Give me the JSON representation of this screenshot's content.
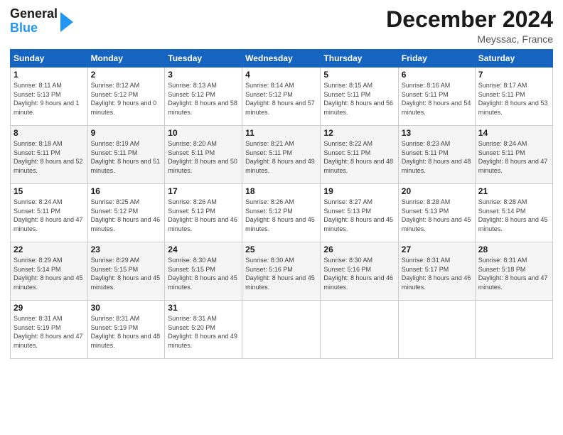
{
  "logo": {
    "general": "General",
    "blue": "Blue"
  },
  "header": {
    "month": "December 2024",
    "location": "Meyssac, France"
  },
  "weekdays": [
    "Sunday",
    "Monday",
    "Tuesday",
    "Wednesday",
    "Thursday",
    "Friday",
    "Saturday"
  ],
  "weeks": [
    [
      {
        "day": "1",
        "sunrise": "8:11 AM",
        "sunset": "5:13 PM",
        "daylight": "9 hours and 1 minute."
      },
      {
        "day": "2",
        "sunrise": "8:12 AM",
        "sunset": "5:12 PM",
        "daylight": "9 hours and 0 minutes."
      },
      {
        "day": "3",
        "sunrise": "8:13 AM",
        "sunset": "5:12 PM",
        "daylight": "8 hours and 58 minutes."
      },
      {
        "day": "4",
        "sunrise": "8:14 AM",
        "sunset": "5:12 PM",
        "daylight": "8 hours and 57 minutes."
      },
      {
        "day": "5",
        "sunrise": "8:15 AM",
        "sunset": "5:11 PM",
        "daylight": "8 hours and 56 minutes."
      },
      {
        "day": "6",
        "sunrise": "8:16 AM",
        "sunset": "5:11 PM",
        "daylight": "8 hours and 54 minutes."
      },
      {
        "day": "7",
        "sunrise": "8:17 AM",
        "sunset": "5:11 PM",
        "daylight": "8 hours and 53 minutes."
      }
    ],
    [
      {
        "day": "8",
        "sunrise": "8:18 AM",
        "sunset": "5:11 PM",
        "daylight": "8 hours and 52 minutes."
      },
      {
        "day": "9",
        "sunrise": "8:19 AM",
        "sunset": "5:11 PM",
        "daylight": "8 hours and 51 minutes."
      },
      {
        "day": "10",
        "sunrise": "8:20 AM",
        "sunset": "5:11 PM",
        "daylight": "8 hours and 50 minutes."
      },
      {
        "day": "11",
        "sunrise": "8:21 AM",
        "sunset": "5:11 PM",
        "daylight": "8 hours and 49 minutes."
      },
      {
        "day": "12",
        "sunrise": "8:22 AM",
        "sunset": "5:11 PM",
        "daylight": "8 hours and 48 minutes."
      },
      {
        "day": "13",
        "sunrise": "8:23 AM",
        "sunset": "5:11 PM",
        "daylight": "8 hours and 48 minutes."
      },
      {
        "day": "14",
        "sunrise": "8:24 AM",
        "sunset": "5:11 PM",
        "daylight": "8 hours and 47 minutes."
      }
    ],
    [
      {
        "day": "15",
        "sunrise": "8:24 AM",
        "sunset": "5:11 PM",
        "daylight": "8 hours and 47 minutes."
      },
      {
        "day": "16",
        "sunrise": "8:25 AM",
        "sunset": "5:12 PM",
        "daylight": "8 hours and 46 minutes."
      },
      {
        "day": "17",
        "sunrise": "8:26 AM",
        "sunset": "5:12 PM",
        "daylight": "8 hours and 46 minutes."
      },
      {
        "day": "18",
        "sunrise": "8:26 AM",
        "sunset": "5:12 PM",
        "daylight": "8 hours and 45 minutes."
      },
      {
        "day": "19",
        "sunrise": "8:27 AM",
        "sunset": "5:13 PM",
        "daylight": "8 hours and 45 minutes."
      },
      {
        "day": "20",
        "sunrise": "8:28 AM",
        "sunset": "5:13 PM",
        "daylight": "8 hours and 45 minutes."
      },
      {
        "day": "21",
        "sunrise": "8:28 AM",
        "sunset": "5:14 PM",
        "daylight": "8 hours and 45 minutes."
      }
    ],
    [
      {
        "day": "22",
        "sunrise": "8:29 AM",
        "sunset": "5:14 PM",
        "daylight": "8 hours and 45 minutes."
      },
      {
        "day": "23",
        "sunrise": "8:29 AM",
        "sunset": "5:15 PM",
        "daylight": "8 hours and 45 minutes."
      },
      {
        "day": "24",
        "sunrise": "8:30 AM",
        "sunset": "5:15 PM",
        "daylight": "8 hours and 45 minutes."
      },
      {
        "day": "25",
        "sunrise": "8:30 AM",
        "sunset": "5:16 PM",
        "daylight": "8 hours and 45 minutes."
      },
      {
        "day": "26",
        "sunrise": "8:30 AM",
        "sunset": "5:16 PM",
        "daylight": "8 hours and 46 minutes."
      },
      {
        "day": "27",
        "sunrise": "8:31 AM",
        "sunset": "5:17 PM",
        "daylight": "8 hours and 46 minutes."
      },
      {
        "day": "28",
        "sunrise": "8:31 AM",
        "sunset": "5:18 PM",
        "daylight": "8 hours and 47 minutes."
      }
    ],
    [
      {
        "day": "29",
        "sunrise": "8:31 AM",
        "sunset": "5:19 PM",
        "daylight": "8 hours and 47 minutes."
      },
      {
        "day": "30",
        "sunrise": "8:31 AM",
        "sunset": "5:19 PM",
        "daylight": "8 hours and 48 minutes."
      },
      {
        "day": "31",
        "sunrise": "8:31 AM",
        "sunset": "5:20 PM",
        "daylight": "8 hours and 49 minutes."
      },
      null,
      null,
      null,
      null
    ]
  ]
}
